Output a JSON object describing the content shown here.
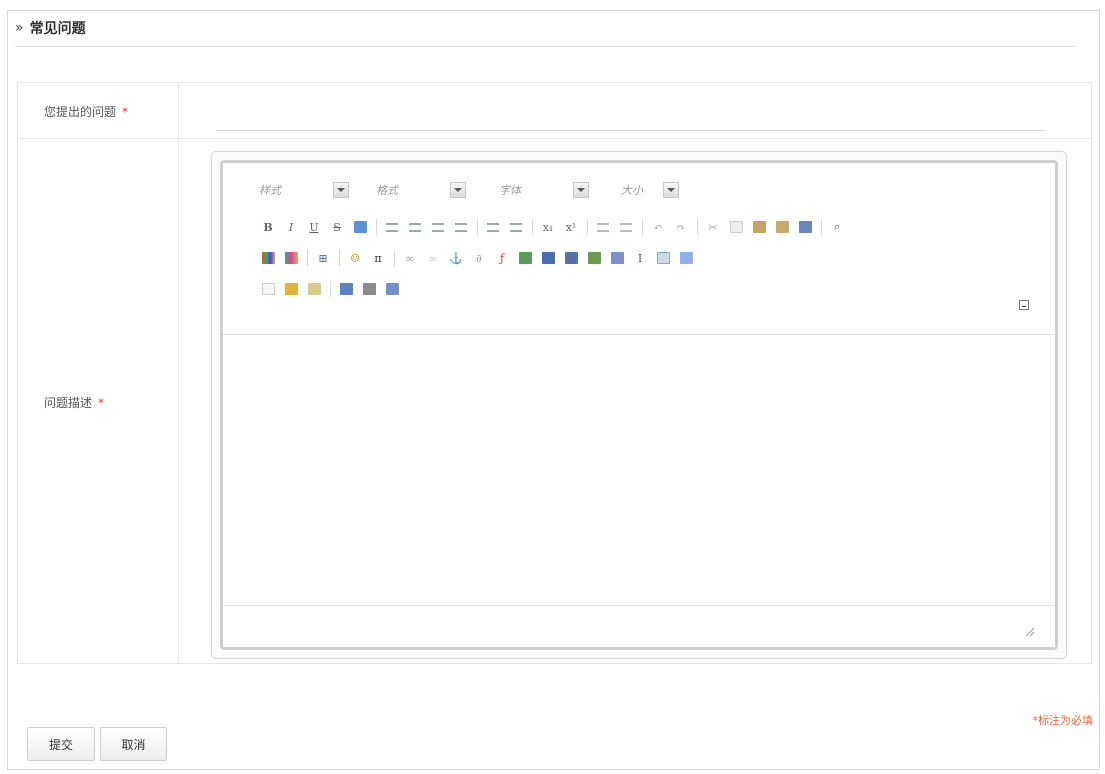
{
  "header": {
    "title": "常见问题",
    "chevron": "»"
  },
  "form": {
    "question_label": "您提出的问题",
    "description_label": "问题描述",
    "required_mark": "*",
    "question_value": ""
  },
  "editor": {
    "combos": [
      "样式",
      "格式",
      "字体",
      "大小"
    ],
    "toolbar_icons": [
      "bold-icon",
      "italic-icon",
      "underline-icon",
      "strikethrough-icon",
      "highlight-icon",
      "align-left-icon",
      "align-center-icon",
      "align-right-icon",
      "justify-icon",
      "numbered-list-icon",
      "bulleted-list-icon",
      "subscript-icon",
      "superscript-icon",
      "outdent-icon",
      "indent-icon",
      "undo-icon",
      "redo-icon",
      "cut-icon",
      "copy-icon",
      "paste-icon",
      "paste-text-icon",
      "paste-word-icon",
      "find-icon",
      "text-color-icon",
      "background-color-icon",
      "table-icon",
      "smiley-icon",
      "formula-icon",
      "link-icon",
      "unlink-icon",
      "anchor-icon",
      "attachment-icon",
      "flash-icon",
      "image-icon",
      "video-icon",
      "form-icon",
      "picture-edit-icon",
      "iframe-icon",
      "textfield-icon",
      "select-icon",
      "template-icon",
      "new-page-icon",
      "clean-format-icon",
      "spellcheck-icon",
      "preview-icon",
      "print-icon",
      "source-icon"
    ],
    "body": ""
  },
  "buttons": {
    "submit": "提交",
    "cancel": "取消"
  },
  "note": "*标注为必填",
  "colors": {
    "required": "#e03c2f",
    "note": "#e8673c",
    "border": "#e6e6e6"
  }
}
